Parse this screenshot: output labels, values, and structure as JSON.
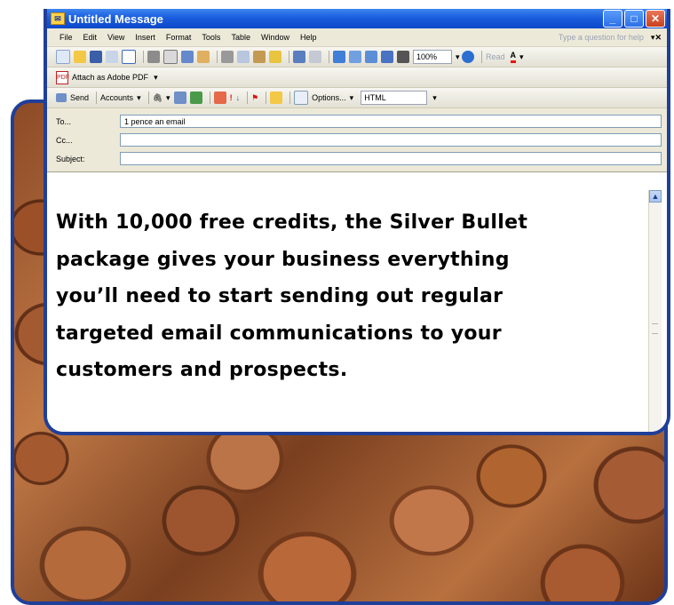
{
  "window": {
    "title": "Untitled Message"
  },
  "menu": {
    "items": [
      "File",
      "Edit",
      "View",
      "Insert",
      "Format",
      "Tools",
      "Table",
      "Window",
      "Help"
    ],
    "help_placeholder": "Type a question for help"
  },
  "toolbar": {
    "zoom": "100%",
    "read_label": "Read",
    "font_color_label": "A"
  },
  "toolbar2": {
    "attach_pdf_label": "Attach as Adobe PDF"
  },
  "toolbar3": {
    "send_label": "Send",
    "accounts_label": "Accounts",
    "options_label": "Options...",
    "format_value": "HTML"
  },
  "fields": {
    "to_label": "To...",
    "to_value": "1 pence an email",
    "cc_label": "Cc...",
    "cc_value": "",
    "subject_label": "Subject:",
    "subject_value": ""
  },
  "body": {
    "lines": [
      "With 10,000 free credits, the Silver Bullet",
      "package gives your business everything",
      "you’ll need to start sending out regular",
      "targeted email communications to your",
      "customers and prospects."
    ]
  }
}
